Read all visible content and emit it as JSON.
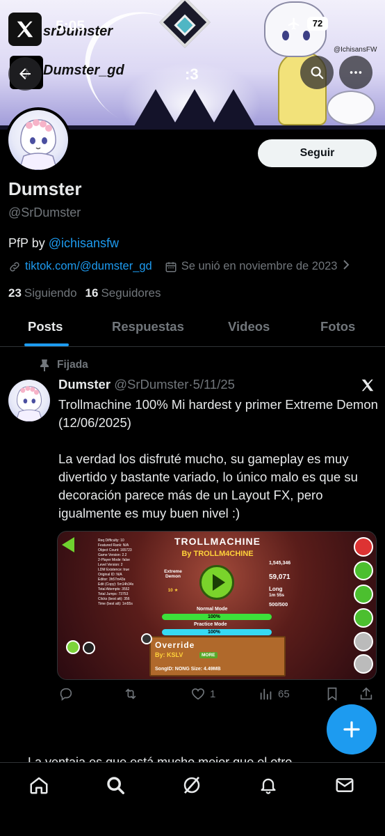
{
  "status_bar": {
    "time": "5:05",
    "battery": "72"
  },
  "banner": {
    "x_username": "srDumster",
    "tiktok_username": "Dumster_gd",
    "art_credit_tag": "@IchisansFW",
    "caption": ":3"
  },
  "header_actions": {
    "back": "back",
    "search": "search",
    "more": "more"
  },
  "profile": {
    "follow_label": "Seguir",
    "display_name": "Dumster",
    "handle": "@SrDumster",
    "bio_prefix": "PfP by ",
    "bio_mention": "@ichisansfw",
    "website": "tiktok.com/@dumster_gd",
    "joined": "Se unió en noviembre de 2023",
    "following_count": "23",
    "following_label": "Siguiendo",
    "followers_count": "16",
    "followers_label": "Seguidores"
  },
  "tabs": [
    {
      "label": "Posts",
      "active": true
    },
    {
      "label": "Respuestas",
      "active": false
    },
    {
      "label": "Videos",
      "active": false
    },
    {
      "label": "Fotos",
      "active": false
    }
  ],
  "post": {
    "pinned_label": "Fijada",
    "author_name": "Dumster",
    "author_handle": "@SrDumster",
    "separator": "·",
    "date": "5/11/25",
    "text": "Trollmachine 100% Mi hardest y primer Extreme Demon (12/06/2025)\n\nLa verdad los disfruté mucho, su gameplay es muy divertido y bastante variado, lo único malo es que su decoración parece más de un Layout FX, pero igualmente es muy buen nivel :)",
    "media": {
      "level_title": "TROLLMACHINE",
      "level_author": "By TROLLM4CHINE",
      "difficulty": "Extreme Demon",
      "difficulty_stars": "10 ★",
      "normal_mode_label": "Normal Mode",
      "normal_mode_progress": "100%",
      "normal_mode_fraction": 1.0,
      "practice_mode_label": "Practice Mode",
      "practice_mode_progress": "100%",
      "practice_mode_fraction": 1.0,
      "downloads": "1,545,346",
      "likes": "59,071",
      "length": "Long",
      "length_time": "1m 55s",
      "orbs": "500/500",
      "song_name": "Override",
      "song_by": "By: KSLV",
      "song_more": "MORE",
      "song_info": "SongID: NONG  Size: 4.49MB",
      "info_text": "Req Difficulty: 10\nFeatured Rank: N/A\nObject Count: 165723\nGame Version: 2.2\n2-Player Mode: false\nLevel Version: 2\nLDM Existence: true\nOriginal ID: N/A\nEditor: 3h57m43s\nEdit (Copy): 5m14h34s\nTotal Attempts: 3552\nTotal Jumps: 73753\nClicks (best att): 356\nTime (best att): 1m55s"
    },
    "actions": {
      "reply_count": "",
      "repost_count": "",
      "like_count": "1",
      "views_count": "65"
    }
  },
  "next_post_peek": "La ventaja es que está mucho mejor que el otro",
  "colors": {
    "accent": "#1d9bf0",
    "background": "#000000",
    "muted": "#71767b",
    "text": "#e7e9ea"
  },
  "bottom_nav": [
    {
      "icon": "home-icon"
    },
    {
      "icon": "search-icon"
    },
    {
      "icon": "grok-icon"
    },
    {
      "icon": "bell-icon"
    },
    {
      "icon": "mail-icon"
    }
  ]
}
